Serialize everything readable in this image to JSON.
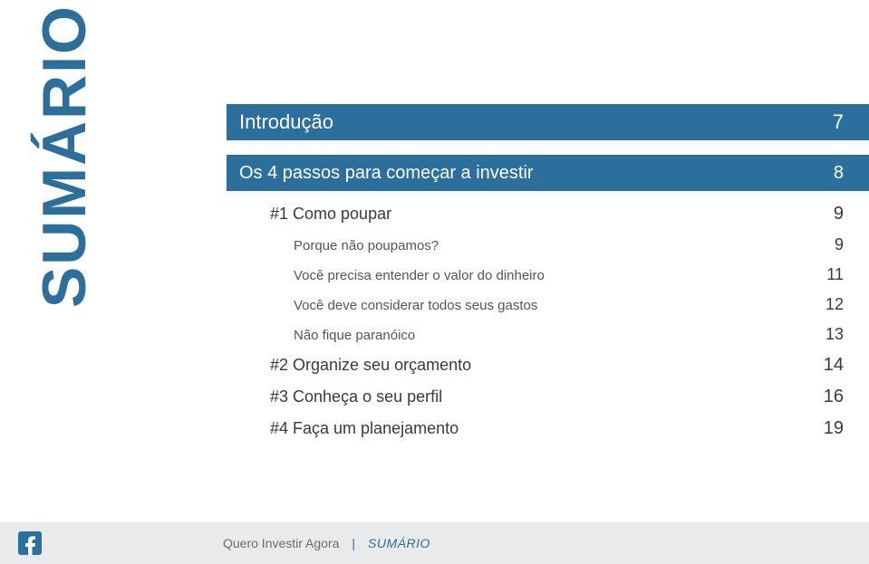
{
  "sidebar": {
    "vertical_title": "SUMÁRIO"
  },
  "toc": {
    "top_bar": {
      "label": "Introdução",
      "page": "7"
    },
    "section_bar": {
      "label": "Os 4 passos para começar a investir",
      "page": "8"
    },
    "entries": [
      {
        "level": 1,
        "label": "#1 Como poupar",
        "page": "9"
      },
      {
        "level": 2,
        "label": "Porque não poupamos?",
        "page": "9"
      },
      {
        "level": 2,
        "label": "Você precisa entender o valor do dinheiro",
        "page": "11"
      },
      {
        "level": 2,
        "label": "Você deve considerar todos seus gastos",
        "page": "12"
      },
      {
        "level": 2,
        "label": "Não fique paranóico",
        "page": "13"
      },
      {
        "level": 1,
        "label": "#2 Organize seu orçamento",
        "page": "14"
      },
      {
        "level": 1,
        "label": "#3 Conheça o seu perfil",
        "page": "16"
      },
      {
        "level": 1,
        "label": "#4 Faça um planejamento",
        "page": "19"
      }
    ]
  },
  "footer": {
    "brand": "Quero Investir Agora",
    "separator": "|",
    "crumb": "SUMÁRIO"
  }
}
